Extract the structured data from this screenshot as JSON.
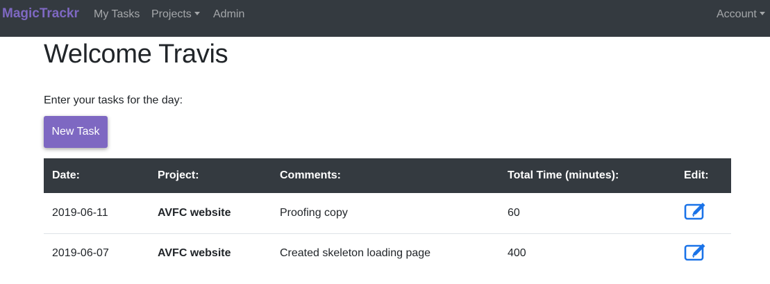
{
  "nav": {
    "brand": "MagicTrackr",
    "items": [
      {
        "label": "My Tasks"
      },
      {
        "label": "Projects"
      },
      {
        "label": "Admin"
      }
    ],
    "account_label": "Account"
  },
  "main": {
    "title": "Welcome Travis",
    "intro": "Enter your tasks for the day:",
    "new_task_label": "New Task"
  },
  "table": {
    "headers": [
      "Date:",
      "Project:",
      "Comments:",
      "Total Time (minutes):",
      "Edit:"
    ],
    "rows": [
      {
        "date": "2019-06-11",
        "project": "AVFC website",
        "comments": "Proofing copy",
        "total_time": "60",
        "edit_icon": "edit-icon"
      },
      {
        "date": "2019-06-07",
        "project": "AVFC website",
        "comments": "Created skeleton loading page",
        "total_time": "400",
        "edit_icon": "edit-icon"
      }
    ]
  },
  "colors": {
    "brand": "#7e68c2",
    "navbar_bg": "#343a40",
    "edit_icon": "#1a73e8"
  }
}
